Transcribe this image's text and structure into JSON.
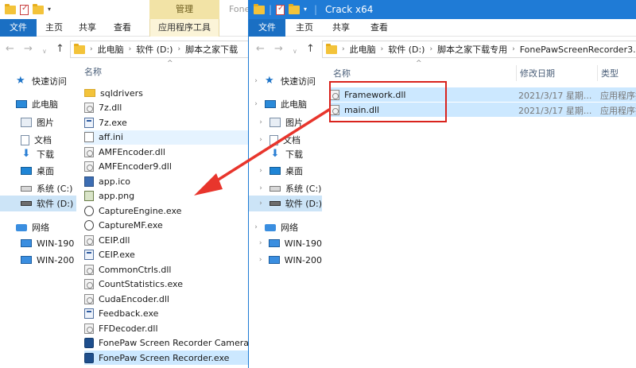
{
  "left_window": {
    "title_ghost": "Fone",
    "manage_tab": "管理",
    "ribbon_tabs": [
      "文件",
      "主页",
      "共享",
      "查看",
      "应用程序工具"
    ],
    "breadcrumb": [
      "此电脑",
      "软件 (D:)",
      "脚本之家下载"
    ],
    "col_name": "名称",
    "nav": [
      {
        "label": "快速访问",
        "icon": "star-icon"
      },
      {
        "label": "此电脑",
        "icon": "pc-icon"
      },
      {
        "label": "图片",
        "icon": "pictures-icon"
      },
      {
        "label": "文档",
        "icon": "documents-icon"
      },
      {
        "label": "下载",
        "icon": "download-icon"
      },
      {
        "label": "桌面",
        "icon": "desktop-icon"
      },
      {
        "label": "系统 (C:)",
        "icon": "drive-c-icon"
      },
      {
        "label": "软件 (D:)",
        "icon": "drive-d-icon"
      },
      {
        "label": "网络",
        "icon": "network-icon"
      },
      {
        "label": "WIN-190",
        "icon": "computer-icon"
      },
      {
        "label": "WIN-200",
        "icon": "computer-icon"
      }
    ],
    "files": [
      {
        "name": "sqldrivers",
        "type": "folder"
      },
      {
        "name": "7z.dll",
        "type": "dll"
      },
      {
        "name": "7z.exe",
        "type": "exe"
      },
      {
        "name": "aff.ini",
        "type": "ini"
      },
      {
        "name": "AMFEncoder.dll",
        "type": "dll"
      },
      {
        "name": "AMFEncoder9.dll",
        "type": "dll"
      },
      {
        "name": "app.ico",
        "type": "ico"
      },
      {
        "name": "app.png",
        "type": "png"
      },
      {
        "name": "CaptureEngine.exe",
        "type": "cap"
      },
      {
        "name": "CaptureMF.exe",
        "type": "cap"
      },
      {
        "name": "CEIP.dll",
        "type": "dll"
      },
      {
        "name": "CEIP.exe",
        "type": "exe"
      },
      {
        "name": "CommonCtrls.dll",
        "type": "dll"
      },
      {
        "name": "CountStatistics.exe",
        "type": "dll"
      },
      {
        "name": "CudaEncoder.dll",
        "type": "dll"
      },
      {
        "name": "Feedback.exe",
        "type": "exe"
      },
      {
        "name": "FFDecoder.dll",
        "type": "dll"
      },
      {
        "name": "FonePaw Screen Recorder Camera.e",
        "type": "app"
      },
      {
        "name": "FonePaw Screen Recorder.exe",
        "type": "app"
      }
    ]
  },
  "right_window": {
    "title": "Crack x64",
    "ribbon_tabs": [
      "文件",
      "主页",
      "共享",
      "查看"
    ],
    "breadcrumb": [
      "此电脑",
      "软件 (D:)",
      "脚本之家下载专用",
      "FonePawScreenRecorder3."
    ],
    "columns": {
      "name": "名称",
      "date": "修改日期",
      "type": "类型"
    },
    "nav": [
      {
        "label": "快速访问",
        "icon": "star-icon"
      },
      {
        "label": "此电脑",
        "icon": "pc-icon"
      },
      {
        "label": "图片",
        "icon": "pictures-icon"
      },
      {
        "label": "文档",
        "icon": "documents-icon"
      },
      {
        "label": "下载",
        "icon": "download-icon"
      },
      {
        "label": "桌面",
        "icon": "desktop-icon"
      },
      {
        "label": "系统 (C:)",
        "icon": "drive-c-icon"
      },
      {
        "label": "软件 (D:)",
        "icon": "drive-d-icon"
      },
      {
        "label": "网络",
        "icon": "network-icon"
      },
      {
        "label": "WIN-190",
        "icon": "computer-icon"
      },
      {
        "label": "WIN-200",
        "icon": "computer-icon"
      }
    ],
    "files": [
      {
        "name": "Framework.dll",
        "date": "2021/3/17 星期...",
        "type": "应用程序扩"
      },
      {
        "name": "main.dll",
        "date": "2021/3/17 星期...",
        "type": "应用程序扩"
      }
    ]
  },
  "colors": {
    "accent": "#1f7bd6",
    "highlight": "#d9231d",
    "selection": "#cce8ff"
  }
}
